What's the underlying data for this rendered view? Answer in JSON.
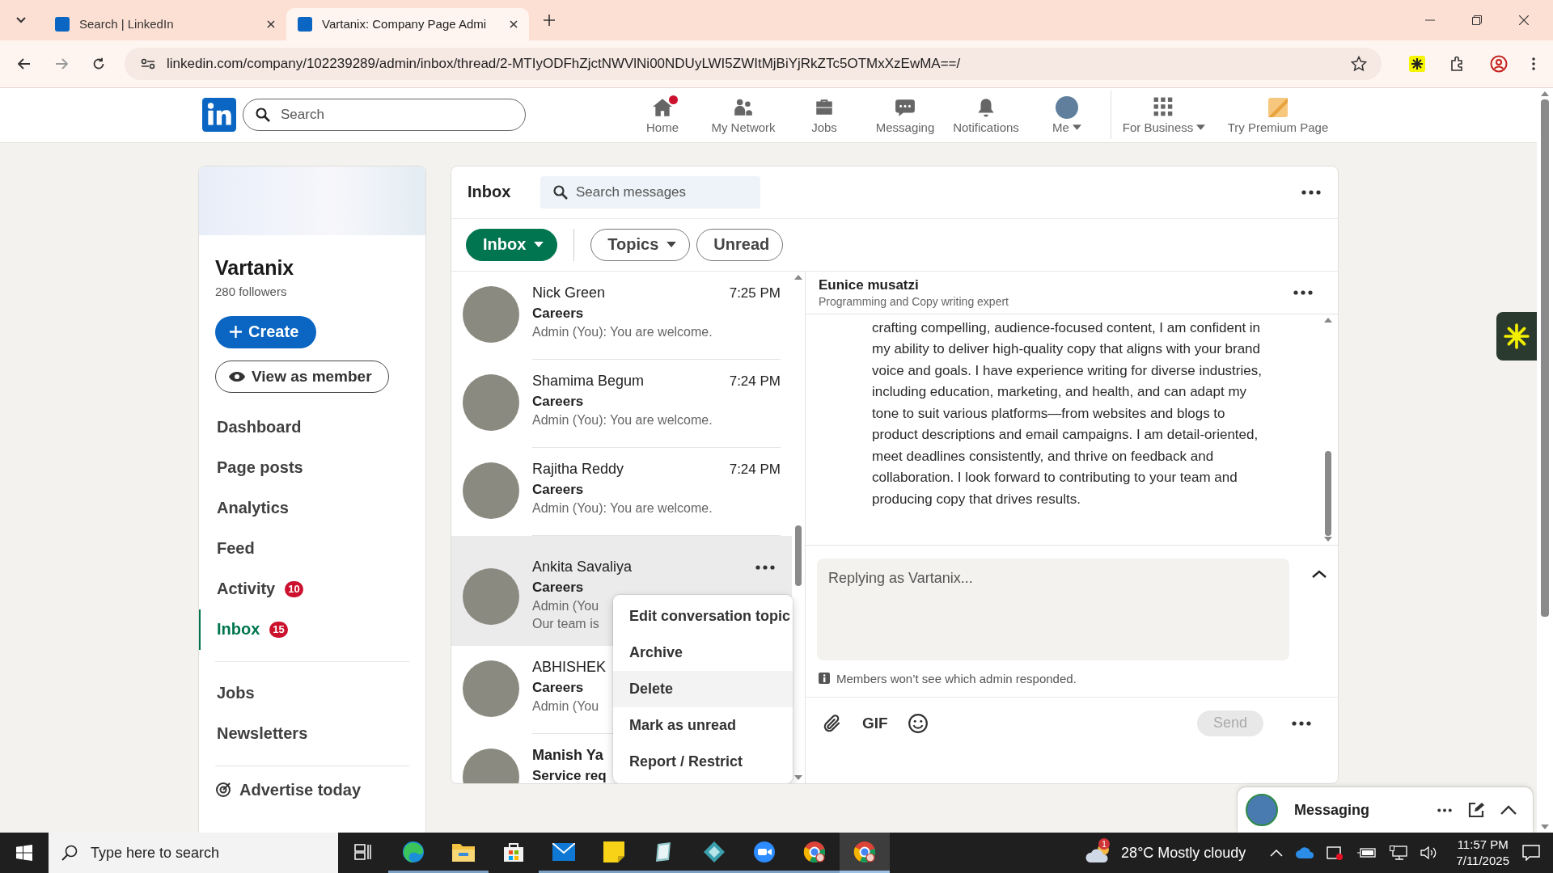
{
  "browser": {
    "tabs": [
      {
        "title": "Search | LinkedIn",
        "selected": false
      },
      {
        "title": "Vartanix: Company Page Admi",
        "selected": true
      }
    ],
    "url": "linkedin.com/company/102239289/admin/inbox/thread/2-MTIyODFhZjctNWVlNi00NDUyLWI5ZWItMjBiYjRkZTc5OTMxXzEwMA==/"
  },
  "nav": {
    "search_placeholder": "Search",
    "items": [
      {
        "kind": "home",
        "label": "Home",
        "dot": true,
        "dropdown": false
      },
      {
        "kind": "network",
        "label": "My Network",
        "dot": false,
        "dropdown": false
      },
      {
        "kind": "jobs",
        "label": "Jobs",
        "dot": false,
        "dropdown": false
      },
      {
        "kind": "messaging",
        "label": "Messaging",
        "dot": false,
        "dropdown": false
      },
      {
        "kind": "notifications",
        "label": "Notifications",
        "dot": false,
        "dropdown": false
      },
      {
        "kind": "me",
        "label": "Me",
        "dot": false,
        "dropdown": true
      },
      {
        "kind": "business",
        "label": "For Business",
        "dot": false,
        "dropdown": true
      },
      {
        "kind": "premium",
        "label": "Try Premium Page",
        "dot": false,
        "dropdown": false
      }
    ]
  },
  "page": {
    "name": "Vartanix",
    "followers": "280 followers",
    "create": "Create",
    "view_member": "View as member",
    "menu": [
      {
        "label": "Dashboard",
        "selected": false
      },
      {
        "label": "Page posts",
        "selected": false
      },
      {
        "label": "Analytics",
        "selected": false
      },
      {
        "label": "Feed",
        "selected": false
      },
      {
        "label": "Activity",
        "badge": "10",
        "selected": false
      },
      {
        "label": "Inbox",
        "badge": "15",
        "selected": true
      }
    ],
    "menu_more": [
      {
        "label": "Jobs",
        "selected": false
      },
      {
        "label": "Newsletters",
        "selected": false
      }
    ],
    "advertise": "Advertise today"
  },
  "inbox": {
    "title": "Inbox",
    "search_placeholder": "Search messages",
    "filters": [
      {
        "label": "Inbox",
        "dropdown": true,
        "selected": true
      },
      {
        "label": "Topics",
        "dropdown": true,
        "selected": false
      },
      {
        "label": "Unread",
        "dropdown": false,
        "selected": false
      }
    ],
    "conversations": [
      {
        "name": "Nick Green",
        "time": "7:25 PM",
        "topic": "Careers",
        "lines": [
          "Admin (You): You are welcome."
        ],
        "unread": false,
        "selected": false
      },
      {
        "name": "Shamima Begum",
        "time": "7:24 PM",
        "topic": "Careers",
        "lines": [
          "Admin (You): You are welcome."
        ],
        "unread": false,
        "selected": false
      },
      {
        "name": "Rajitha Reddy",
        "time": "7:24 PM",
        "topic": "Careers",
        "lines": [
          "Admin (You): You are welcome."
        ],
        "unread": false,
        "selected": false
      },
      {
        "name": "Ankita Savaliya",
        "topic": "Careers",
        "lines": [
          "Admin (You",
          "Our team is"
        ],
        "unread": false,
        "selected": true
      },
      {
        "name": "ABHISHEK",
        "topic": "Careers",
        "lines": [
          "Admin (You"
        ],
        "unread": false,
        "selected": false
      },
      {
        "name": "Manish Ya",
        "topic": "Service req",
        "unread": true,
        "selected": false
      }
    ],
    "context_menu": [
      {
        "label": "Edit conversation topic",
        "selected": false
      },
      {
        "label": "Archive",
        "selected": false
      },
      {
        "label": "Delete",
        "selected": true
      },
      {
        "label": "Mark as unread",
        "selected": false
      },
      {
        "label": "Report / Restrict",
        "selected": false
      }
    ]
  },
  "conversation": {
    "name": "Eunice musatzi",
    "headline": "Programming and Copy writing expert",
    "message": "crafting compelling, audience-focused content, I am confident in my ability to deliver high-quality copy that aligns with your brand voice and goals. I have experience writing for diverse industries, including education, marketing, and health, and can adapt my tone to suit various platforms—from websites and blogs to product descriptions and email campaigns. I am detail-oriented, meet deadlines consistently, and thrive on feedback and collaboration. I look forward to contributing to your team and producing copy that drives results.",
    "reply_placeholder": "Replying as Vartanix...",
    "note": "Members won’t see which admin responded.",
    "gif": "GIF",
    "send": {
      "label": "Send",
      "disabled": true
    }
  },
  "messaging": {
    "title": "Messaging"
  },
  "taskbar": {
    "search_placeholder": "Type here to search",
    "apps": [
      {
        "kind": "taskview",
        "running": false,
        "selected": false
      },
      {
        "kind": "edge",
        "running": true,
        "selected": false
      },
      {
        "kind": "explorer",
        "running": true,
        "selected": false
      },
      {
        "kind": "store",
        "running": false,
        "selected": false
      },
      {
        "kind": "mail",
        "running": true,
        "selected": false
      },
      {
        "kind": "notes",
        "running": true,
        "selected": false
      },
      {
        "kind": "book",
        "running": true,
        "selected": false
      },
      {
        "kind": "diamond",
        "running": true,
        "selected": false
      },
      {
        "kind": "zoom",
        "running": true,
        "selected": false
      },
      {
        "kind": "chrome",
        "running": true,
        "selected": false
      },
      {
        "kind": "chrome",
        "running": true,
        "selected": true
      }
    ],
    "weather": "28°C Mostly cloudy",
    "weather_alert": "1",
    "time": "11:57 PM",
    "date": "7/11/2025"
  }
}
